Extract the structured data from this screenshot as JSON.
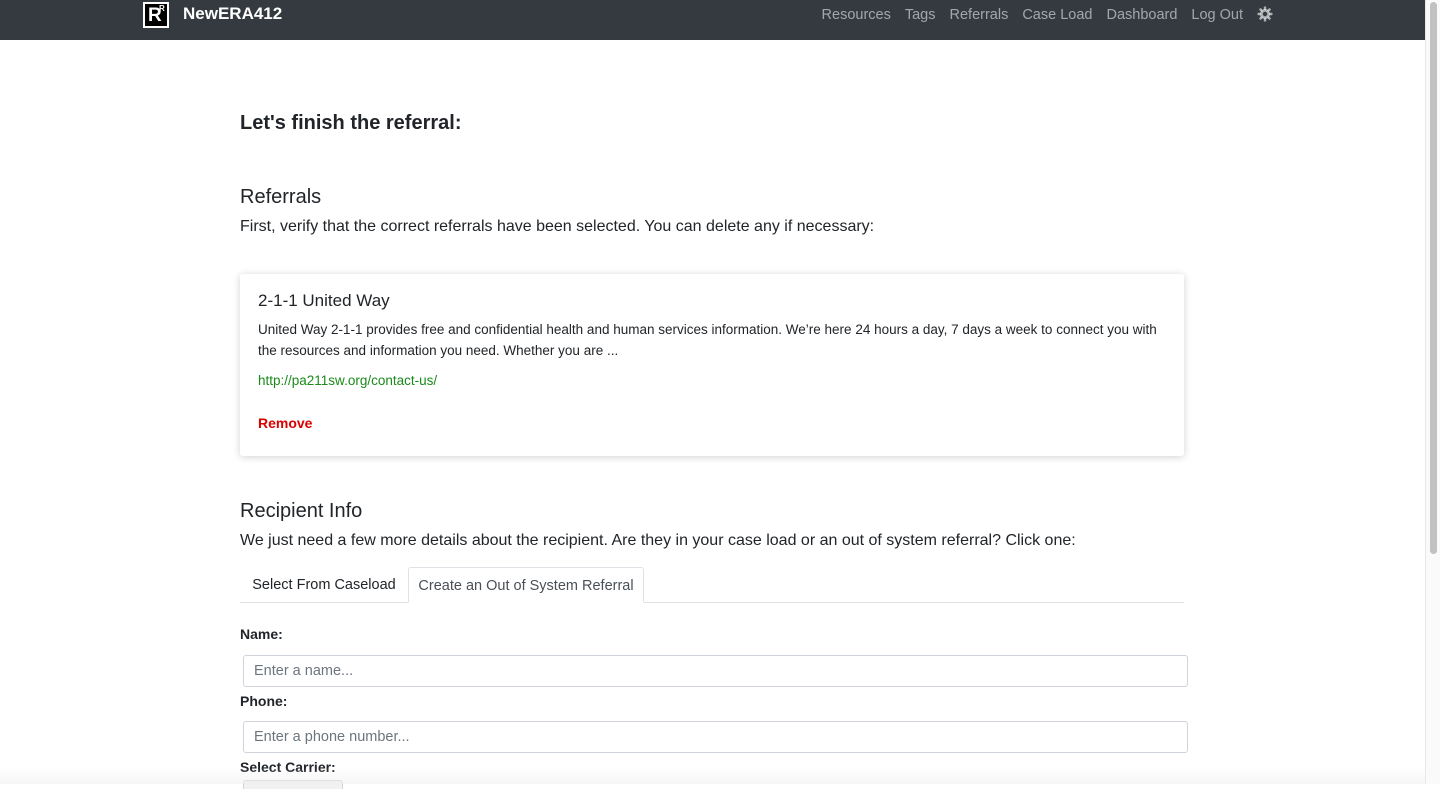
{
  "nav": {
    "brand": "NewERA412",
    "logo_text": "R",
    "logo_sup": "R",
    "links": [
      "Resources",
      "Tags",
      "Referrals",
      "Case Load",
      "Dashboard",
      "Log Out"
    ],
    "settings_icon": "gear-icon"
  },
  "page": {
    "title": "Let's finish the referral:"
  },
  "referrals": {
    "heading": "Referrals",
    "instructions": "First, verify that the correct referrals have been selected. You can delete any if necessary:",
    "items": [
      {
        "name": "2-1-1 United Way",
        "description": "United Way 2-1-1 provides free and confidential health and human services information. We’re here 24 hours a day, 7 days a week to connect you with the resources and information you need. Whether you are ...",
        "url": "http://pa211sw.org/contact-us/",
        "remove_label": "Remove"
      }
    ]
  },
  "recipient": {
    "heading": "Recipient Info",
    "instructions": "We just need a few more details about the recipient. Are they in your case load or an out of system referral? Click one:",
    "tabs": [
      "Select From Caseload",
      "Create an Out of System Referral"
    ],
    "active_tab": "Create an Out of System Referral",
    "fields": {
      "name_label": "Name:",
      "name_placeholder": "Enter a name...",
      "phone_label": "Phone:",
      "phone_placeholder": "Enter a phone number...",
      "carrier_label": "Select Carrier:"
    }
  },
  "colors": {
    "navbar": "#343a40",
    "link_green": "#1a8a1a",
    "remove_red": "#d90000"
  }
}
